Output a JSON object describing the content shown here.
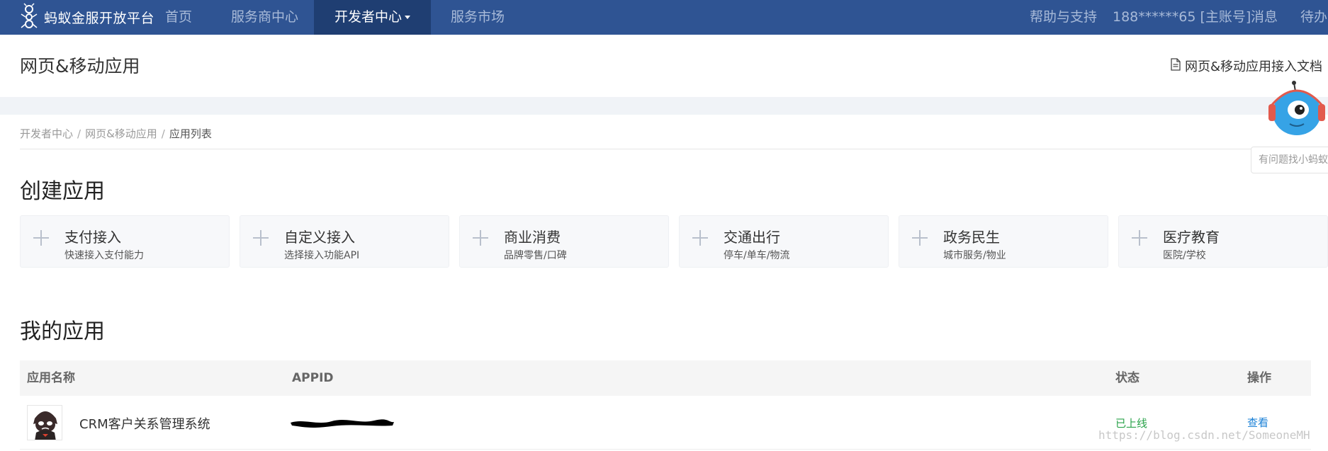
{
  "nav": {
    "brand": "蚂蚁金服开放平台",
    "items": [
      {
        "label": "首页"
      },
      {
        "label": "服务商中心"
      },
      {
        "label": "开发者中心"
      },
      {
        "label": "服务市场"
      }
    ],
    "right": {
      "help": "帮助与支持",
      "account": "188******65 [主账号]",
      "messages": "消息",
      "todo": "待办"
    }
  },
  "header": {
    "title": "网页&移动应用",
    "doc_link": "网页&移动应用接入文档"
  },
  "breadcrumb": [
    {
      "label": "开发者中心"
    },
    {
      "label": "网页&移动应用"
    },
    {
      "label": "应用列表"
    }
  ],
  "create": {
    "title": "创建应用",
    "cards": [
      {
        "title": "支付接入",
        "subtitle": "快速接入支付能力"
      },
      {
        "title": "自定义接入",
        "subtitle": "选择接入功能API"
      },
      {
        "title": "商业消费",
        "subtitle": "品牌零售/口碑"
      },
      {
        "title": "交通出行",
        "subtitle": "停车/单车/物流"
      },
      {
        "title": "政务民生",
        "subtitle": "城市服务/物业"
      },
      {
        "title": "医疗教育",
        "subtitle": "医院/学校"
      }
    ]
  },
  "my_apps": {
    "title": "我的应用",
    "columns": {
      "name": "应用名称",
      "appid": "APPID",
      "status": "状态",
      "action": "操作"
    },
    "rows": [
      {
        "name": "CRM客户关系管理系统",
        "status": "已上线",
        "action": "查看"
      }
    ]
  },
  "assistant": {
    "tip": "有问题找小蚂蚁"
  },
  "watermark": "https://blog.csdn.net/SomeoneMH",
  "colors": {
    "nav_bg": "#2f5493",
    "nav_active_bg": "#1f3e72",
    "status_online": "#2aa34a",
    "link": "#1a80d6"
  }
}
